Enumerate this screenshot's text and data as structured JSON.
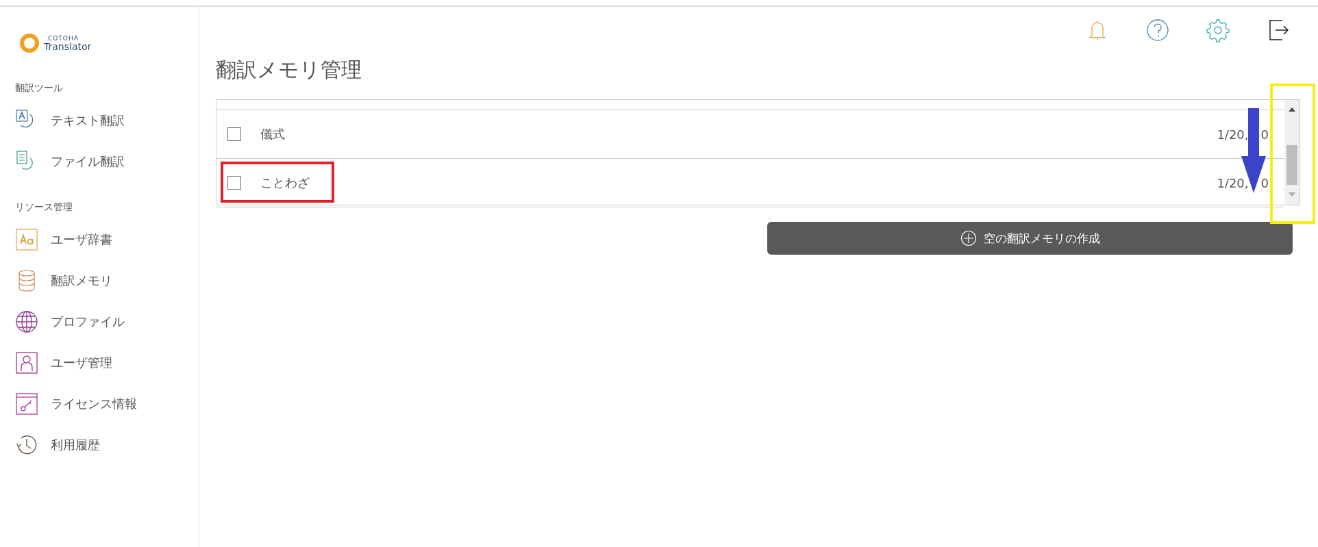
{
  "sidebar": {
    "logo": {
      "line_1": "COTOHA",
      "line_2": "Translator"
    },
    "sections": [
      {
        "heading": "翻訳ツール",
        "items": [
          {
            "kind": "text",
            "label": "テキスト翻訳"
          },
          {
            "kind": "file",
            "label": "ファイル翻訳"
          }
        ]
      },
      {
        "heading": "リソース管理",
        "items": [
          {
            "kind": "dictionary",
            "label": "ユーザ辞書"
          },
          {
            "kind": "memory",
            "label": "翻訳メモリ"
          },
          {
            "kind": "profile",
            "label": "プロファイル"
          },
          {
            "kind": "user",
            "label": "ユーザ管理"
          },
          {
            "kind": "license",
            "label": "ライセンス情報"
          },
          {
            "kind": "history",
            "label": "利用履歴"
          }
        ]
      }
    ]
  },
  "title": "翻訳メモリ管理",
  "table": {
    "rows": [
      {
        "name": "儀式",
        "count_start": "1/20,",
        "count_end": "0",
        "checked": false
      },
      {
        "name": "ことわざ",
        "count_start": "1/20,",
        "count_end": "0",
        "checked": false
      }
    ]
  },
  "create_button": {
    "label": "空の翻訳メモリの作成"
  }
}
